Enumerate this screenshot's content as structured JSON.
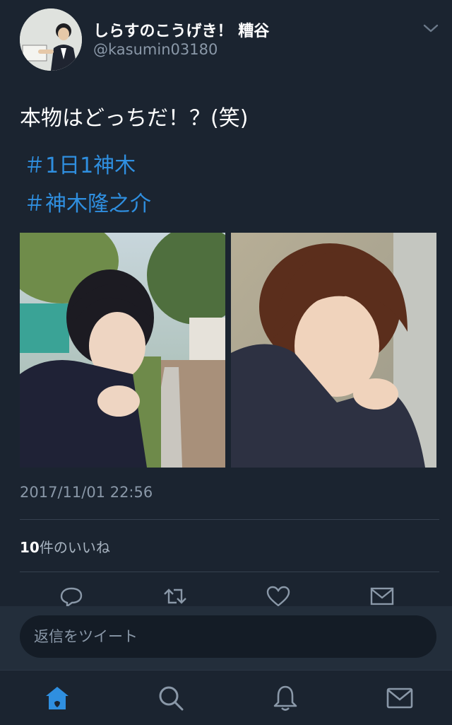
{
  "tweet": {
    "display_name": "しらすのこうげき！ 糟谷",
    "handle": "@kasumin03180",
    "text": "本物はどっちだ！？(笑)",
    "hashtags": [
      "＃1日1神木",
      "＃神木隆之介"
    ],
    "timestamp": "2017/11/01 22:56",
    "likes_count": "10",
    "likes_label": "件のいいね"
  },
  "actions": [
    {
      "icon": "reply-icon"
    },
    {
      "icon": "retweet-icon"
    },
    {
      "icon": "heart-icon"
    },
    {
      "icon": "direct-message-icon"
    }
  ],
  "composer": {
    "placeholder": "返信をツイート"
  },
  "tabbar": [
    {
      "icon": "home-icon",
      "active": true
    },
    {
      "icon": "search-icon",
      "active": false
    },
    {
      "icon": "notifications-icon",
      "active": false
    },
    {
      "icon": "messages-icon",
      "active": false
    }
  ],
  "colors": {
    "background": "#1b2430",
    "hashtag": "#2f8fe0",
    "secondary_text": "#8a98a8",
    "active_tab": "#2f8fe0"
  }
}
